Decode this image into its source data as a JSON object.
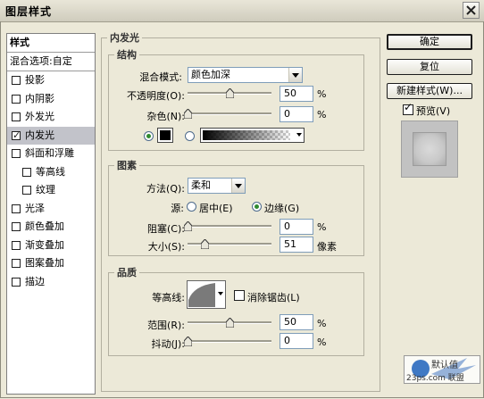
{
  "window": {
    "title": "图层样式"
  },
  "left_panel": {
    "header": "样式",
    "blend_options": "混合选项:自定",
    "items": [
      {
        "label": "投影",
        "checked": false,
        "selected": false,
        "sub": false
      },
      {
        "label": "内阴影",
        "checked": false,
        "selected": false,
        "sub": false
      },
      {
        "label": "外发光",
        "checked": false,
        "selected": false,
        "sub": false
      },
      {
        "label": "内发光",
        "checked": true,
        "selected": true,
        "sub": false
      },
      {
        "label": "斜面和浮雕",
        "checked": false,
        "selected": false,
        "sub": false
      },
      {
        "label": "等高线",
        "checked": false,
        "selected": false,
        "sub": true
      },
      {
        "label": "纹理",
        "checked": false,
        "selected": false,
        "sub": true
      },
      {
        "label": "光泽",
        "checked": false,
        "selected": false,
        "sub": false
      },
      {
        "label": "颜色叠加",
        "checked": false,
        "selected": false,
        "sub": false
      },
      {
        "label": "渐变叠加",
        "checked": false,
        "selected": false,
        "sub": false
      },
      {
        "label": "图案叠加",
        "checked": false,
        "selected": false,
        "sub": false
      },
      {
        "label": "描边",
        "checked": false,
        "selected": false,
        "sub": false
      }
    ]
  },
  "inner_glow": {
    "title": "内发光",
    "structure": {
      "title": "结构",
      "blend_mode_label": "混合模式:",
      "blend_mode_value": "颜色加深",
      "opacity_label": "不透明度(O):",
      "opacity_value": "50",
      "opacity_unit": "%",
      "opacity_fraction": 0.5,
      "noise_label": "杂色(N):",
      "noise_value": "0",
      "noise_unit": "%",
      "noise_fraction": 0.0,
      "color_mode": "solid",
      "swatch_color": "#000000"
    },
    "elements": {
      "title": "图素",
      "method_label": "方法(Q):",
      "method_value": "柔和",
      "source_label": "源:",
      "source_center_label": "居中(E)",
      "source_edge_label": "边缘(G)",
      "source_selected": "edge",
      "choke_label": "阻塞(C):",
      "choke_value": "0",
      "choke_unit": "%",
      "choke_fraction": 0.0,
      "size_label": "大小(S):",
      "size_value": "51",
      "size_unit": "像素",
      "size_fraction": 0.2
    },
    "quality": {
      "title": "品质",
      "contour_label": "等高线:",
      "antialias_label": "消除锯齿(L)",
      "antialias_checked": false,
      "range_label": "范围(R):",
      "range_value": "50",
      "range_unit": "%",
      "range_fraction": 0.5,
      "jitter_label": "抖动(J):",
      "jitter_value": "0",
      "jitter_unit": "%",
      "jitter_fraction": 0.0
    }
  },
  "buttons": {
    "ok": "确定",
    "reset": "复位",
    "new_style": "新建样式(W)...",
    "preview_label": "预览(V)",
    "preview_checked": true
  },
  "watermark": {
    "line1": "默认值",
    "line2": "23ps.com 联盟"
  }
}
